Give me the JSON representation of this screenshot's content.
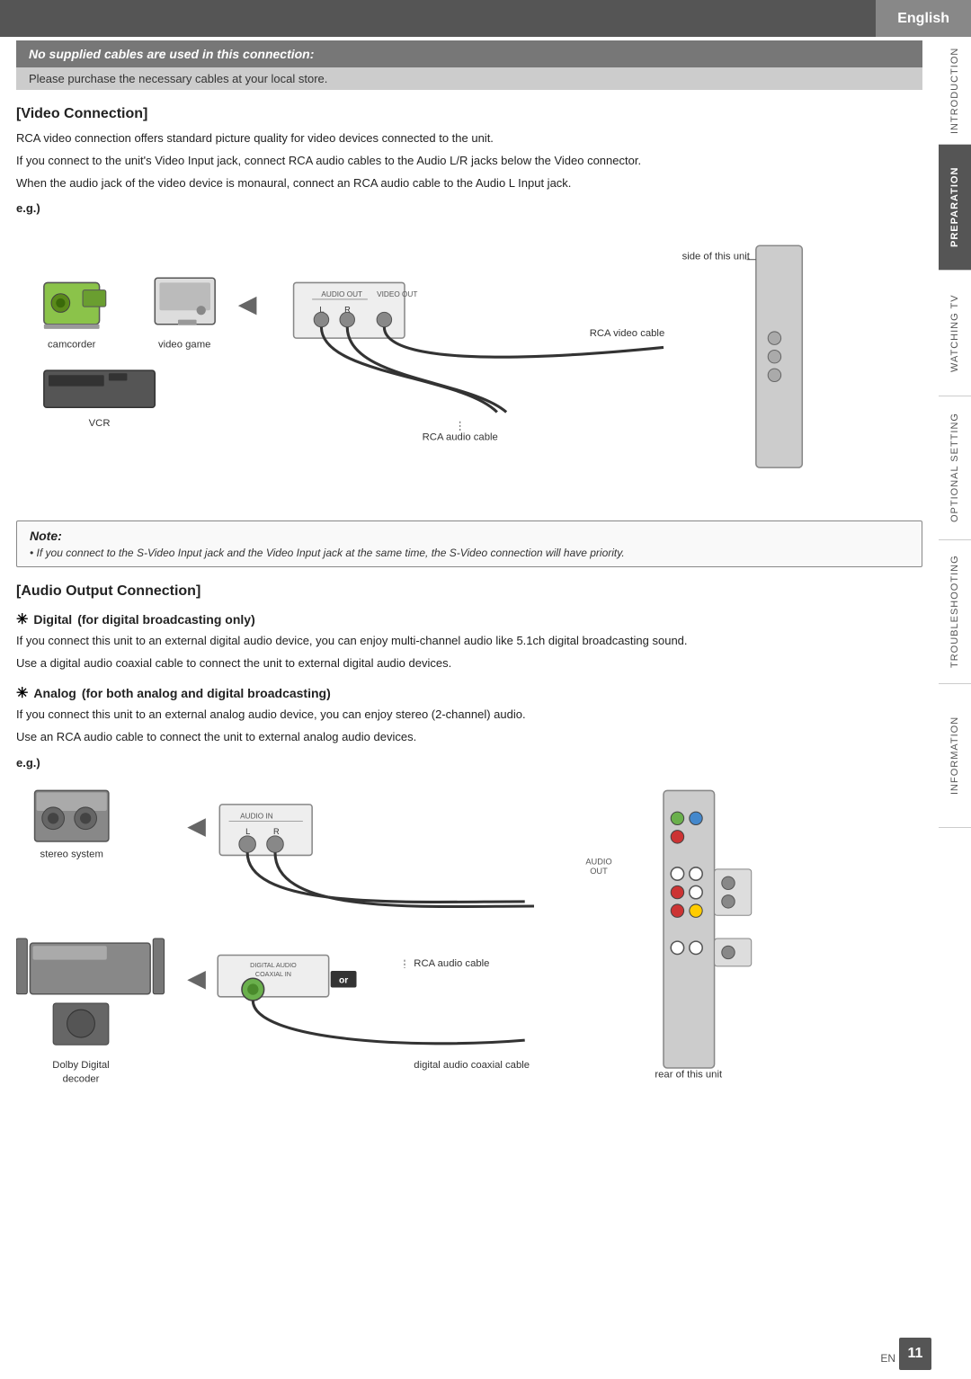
{
  "header": {
    "language": "English"
  },
  "side_tabs": [
    {
      "label": "INTRODUCTION",
      "active": false
    },
    {
      "label": "PREPARATION",
      "active": true
    },
    {
      "label": "WATCHING TV",
      "active": false
    },
    {
      "label": "OPTIONAL SETTING",
      "active": false
    },
    {
      "label": "TROUBLESHOOTING",
      "active": false
    },
    {
      "label": "INFORMATION",
      "active": false
    }
  ],
  "notice": {
    "main": "No supplied cables are used in this connection:",
    "sub": "Please purchase the necessary cables at your local store."
  },
  "video_connection": {
    "heading": "[Video Connection]",
    "paragraphs": [
      "RCA video connection offers standard picture quality for video devices connected to the unit.",
      "If you connect to the unit's Video Input jack, connect RCA audio cables to the Audio L/R jacks below the Video connector.",
      "When the audio jack of the video device is monaural, connect an RCA audio cable to the Audio L Input jack."
    ],
    "eg_label": "e.g.)",
    "diagram_labels": {
      "camcorder": "camcorder",
      "video_game": "video game",
      "vcr": "VCR",
      "rca_video_cable": "RCA video cable",
      "rca_audio_cable": "RCA audio cable",
      "side_of_unit": "side of this unit",
      "audio_out_l": "L",
      "audio_out_r": "R",
      "audio_out_label": "AUDIO OUT",
      "video_out_label": "VIDEO OUT"
    }
  },
  "note": {
    "title": "Note:",
    "text": "• If you connect to the S-Video Input jack and the Video Input jack at the same time, the S-Video connection will have priority."
  },
  "audio_output": {
    "heading": "[Audio Output Connection]",
    "digital": {
      "heading_mark": "✳",
      "heading_text": "Digital",
      "heading_suffix": "(for digital broadcasting only)",
      "paragraphs": [
        "If you connect this unit to an external digital audio device, you can enjoy multi-channel audio like 5.1ch digital broadcasting sound.",
        "Use a digital audio coaxial cable to connect the unit to external digital audio devices."
      ]
    },
    "analog": {
      "heading_mark": "✳",
      "heading_text": "Analog",
      "heading_suffix": "(for both analog and digital broadcasting)",
      "paragraphs": [
        "If you connect this unit to an external analog audio device, you can enjoy stereo (2-channel) audio.",
        "Use an RCA audio cable to connect the unit to external analog audio devices."
      ]
    },
    "eg_label": "e.g.)",
    "diagram_labels": {
      "stereo_system": "stereo system",
      "dolby_digital_decoder": "Dolby Digital\ndecoder",
      "rca_audio_cable": "RCA audio cable",
      "digital_audio_coaxial_cable": "digital audio coaxial cable",
      "rear_of_unit": "rear of this unit",
      "audio_in_l": "L",
      "audio_in_r": "R",
      "audio_in_label": "AUDIO IN",
      "digital_audio_coaxial_in": "DIGITAL AUDIO\nCOAXIAL IN",
      "or_label": "or"
    }
  },
  "page_number": "11",
  "en_label": "EN"
}
